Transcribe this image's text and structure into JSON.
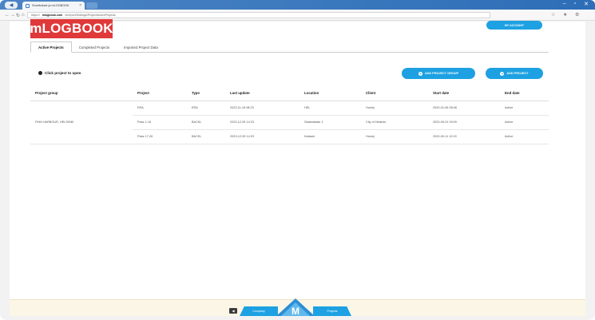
{
  "browser": {
    "tab_title": "Sovellukset ja mLOGBOOK",
    "tab_close": "×",
    "back": "◀",
    "window_controls": [
      "–",
      "▫",
      "✕"
    ],
    "nav": {
      "back": "←",
      "forward": "→",
      "refresh": "↻",
      "home": "⌂"
    },
    "url_prefix": "https://",
    "url_domain": "mlogbook.com",
    "url_rest": "/#/report/Settings/Project/ActiveProjects",
    "right_icons": [
      "☆",
      "★",
      "⚙"
    ]
  },
  "header": {
    "logo": "mLOGBOOK",
    "logout_label": "MY ACCOUNT"
  },
  "tabs": [
    {
      "label": "Active Projects",
      "active": true
    },
    {
      "label": "Completed Projects",
      "active": false
    },
    {
      "label": "Imported Project Data",
      "active": false
    }
  ],
  "toolbar": {
    "click_label": "Click project to open",
    "add_group": "ADD PROJECT GROUP",
    "add_project": "ADD PROJECT",
    "plus": "+"
  },
  "table": {
    "columns": [
      "Project group",
      "Project",
      "Type",
      "Last update",
      "Location",
      "Client",
      "Start date",
      "End date"
    ],
    "group_name": "FINN HARBOUR, HELSINKI",
    "rows": [
      [
        "",
        "ERA",
        "ERA",
        "2023-11-18 08:23",
        "HEL",
        "Honey",
        "2020-01-06 08:46",
        "Active"
      ],
      [
        "",
        "Pass 1-16",
        "BACKL",
        "2023-12-09 14:23",
        "Satamakatu 1",
        "City of Helsinki",
        "2020-09-01 09:00",
        "Active"
      ],
      [
        "",
        "Pass 17-26",
        "BACKL",
        "2023-12-09 14:23",
        "Kalasat",
        "Honey",
        "2020-09-11 12:00",
        "Active"
      ]
    ]
  },
  "footer": {
    "left_btn": "◀",
    "nav_left": "Company",
    "nav_right": "Projects",
    "logo_letter": "M"
  }
}
